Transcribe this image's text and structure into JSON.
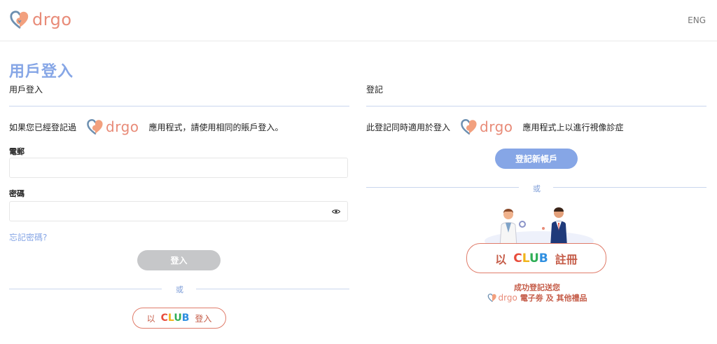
{
  "header": {
    "logo_text": "drgo",
    "lang_label": "ENG"
  },
  "page": {
    "title": "用戶登入"
  },
  "login": {
    "section_label": "用戶登入",
    "intro_before": "如果您已經登記過",
    "intro_logo": "drgo",
    "intro_after": "應用程式，請使用相同的賬戶登入。",
    "email_label": "電郵",
    "email_value": "",
    "password_label": "密碼",
    "password_value": "",
    "forgot_label": "忘記密碼?",
    "login_button": "登入",
    "or_label": "或",
    "club_prefix": "以",
    "club_letters": [
      "C",
      "L",
      "U",
      "B"
    ],
    "club_suffix": "登入"
  },
  "register": {
    "section_label": "登記",
    "intro_before": "此登記同時適用於登入",
    "intro_logo": "drgo",
    "intro_after": "應用程式上以進行視像診症",
    "register_button": "登記新帳戶",
    "or_label": "或",
    "club_prefix": "以",
    "club_letters": [
      "C",
      "L",
      "U",
      "B"
    ],
    "club_suffix": "註冊",
    "promo_line1": "成功登記送您",
    "promo_logo": "drgo",
    "promo_line2": "電子劵 及 其他禮品"
  },
  "colors": {
    "accent_blue": "#86a6e6",
    "brand_coral": "#e88b78",
    "disabled_gray": "#c6c7c9",
    "club_red": "#e84d3c",
    "club_yellow": "#f0b41a",
    "club_green": "#2fae56",
    "club_blue": "#2f8fe0"
  },
  "icons": [
    "drgo-heart-logo-icon",
    "eye-icon"
  ]
}
